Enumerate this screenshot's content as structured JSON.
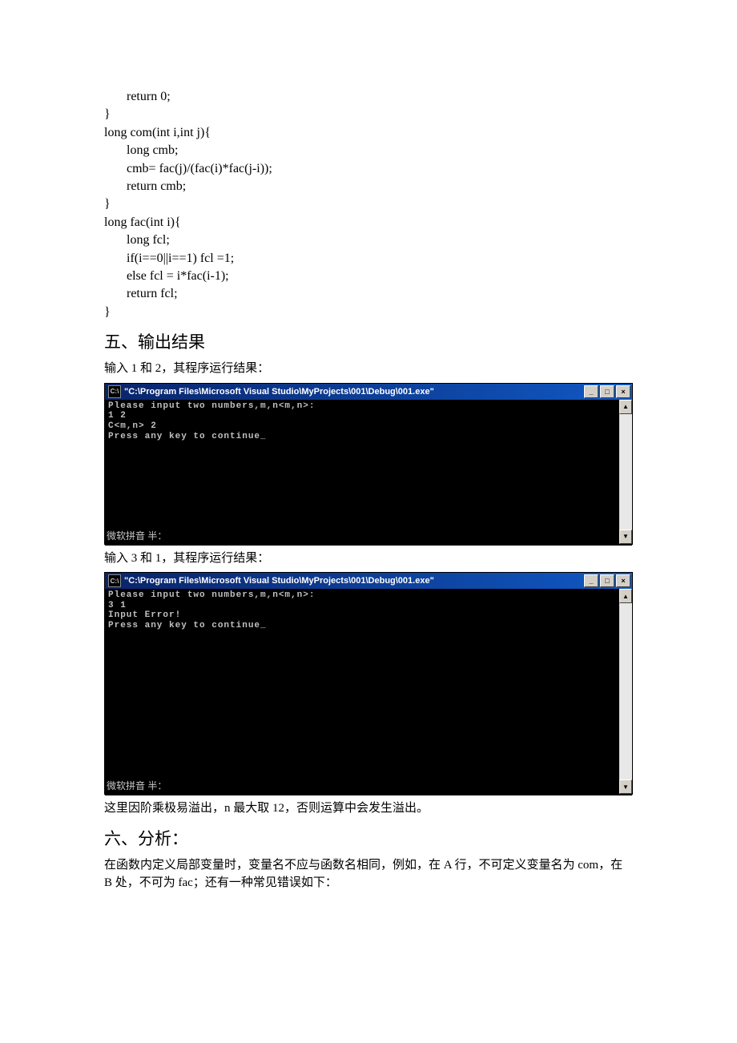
{
  "code": "       return 0;\n}\nlong com(int i,int j){\n       long cmb;\n       cmb= fac(j)/(fac(i)*fac(j-i));\n       return cmb;\n}\nlong fac(int i){\n       long fcl;\n       if(i==0||i==1) fcl =1;\n       else fcl = i*fac(i-1);\n       return fcl;\n}",
  "heading5": "五、输出结果",
  "caption1": "输入 1 和 2，其程序运行结果：",
  "console1": {
    "title": "\"C:\\Program Files\\Microsoft Visual Studio\\MyProjects\\001\\Debug\\001.exe\"",
    "icon": "C:\\",
    "lines": "Please input two numbers,m,n<m,n>:\n1 2\nC<m,n> 2\nPress any key to continue_",
    "ime": "微软拼音  半："
  },
  "caption2": "输入 3 和 1，其程序运行结果：",
  "console2": {
    "title": "\"C:\\Program Files\\Microsoft Visual Studio\\MyProjects\\001\\Debug\\001.exe\"",
    "icon": "C:\\",
    "lines": "Please input two numbers,m,n<m,n>:\n3 1\nInput Error!\nPress any key to continue_",
    "ime": "微软拼音  半："
  },
  "note": "这里因阶乘极易溢出，n 最大取 12，否则运算中会发生溢出。",
  "heading6": "六、分析：",
  "analysis": "在函数内定义局部变量时，变量名不应与函数名相同，例如，在 A 行，不可定义变量名为 com，在 B 处，不可为 fac；还有一种常见错误如下：",
  "buttons": {
    "min": "_",
    "max": "□",
    "close": "×",
    "up": "▲",
    "down": "▼"
  }
}
